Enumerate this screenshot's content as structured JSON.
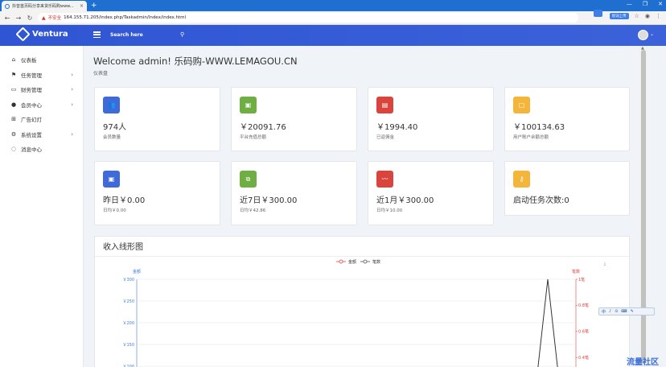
{
  "browser": {
    "tab_title": "抖音首页码分享来货乐码购www...",
    "tab_close": "×",
    "new_tab": "+",
    "controls": [
      "—",
      "❐",
      "✕"
    ],
    "insecure": "不安全",
    "url": "164.155.71.205/index.php/Taskadmin/Index/index.html",
    "ext_badge": "划词上传"
  },
  "header": {
    "brand": "Ventura",
    "search_placeholder": "Search here"
  },
  "sidebar": {
    "items": [
      {
        "label": "仪表板",
        "icon": "home-icon",
        "glyph": "⌂",
        "has_arrow": false
      },
      {
        "label": "任务管理",
        "icon": "flag-icon",
        "glyph": "⚑",
        "has_arrow": true
      },
      {
        "label": "财务管理",
        "icon": "storage-icon",
        "glyph": "▭",
        "has_arrow": true
      },
      {
        "label": "会员中心",
        "icon": "user-icon",
        "glyph": "●",
        "has_arrow": true
      },
      {
        "label": "广告幻灯",
        "icon": "grid-icon",
        "glyph": "⊞",
        "has_arrow": false
      },
      {
        "label": "系统设置",
        "icon": "gear-icon",
        "glyph": "⚙",
        "has_arrow": true
      },
      {
        "label": "消息中心",
        "icon": "message-icon",
        "glyph": "◌",
        "has_arrow": false
      }
    ],
    "arrow": "›"
  },
  "main": {
    "welcome": "Welcome admin! 乐码购-WWW.LEMAGOU.CN",
    "breadcrumb": "仪表盘",
    "cards": [
      {
        "value": "974人",
        "label": "会员数量",
        "color": "#3f6ad8",
        "icon": "users-icon",
        "glyph": "👥"
      },
      {
        "value": "￥20091.76",
        "label": "平台充值总额",
        "color": "#6fae42",
        "icon": "money-icon",
        "glyph": "▣"
      },
      {
        "value": "￥1994.40",
        "label": "已返佣金",
        "color": "#d9453d",
        "icon": "wallet-icon",
        "glyph": "▤"
      },
      {
        "value": "￥100134.63",
        "label": "用户账户余额总额",
        "color": "#f4b63a",
        "icon": "folder-icon",
        "glyph": "▢"
      },
      {
        "value": "昨日￥0.00",
        "label": "日均￥0.00",
        "color": "#3f6ad8",
        "icon": "cash-icon",
        "glyph": "▣"
      },
      {
        "value": "近7日￥300.00",
        "label": "日均￥42.86",
        "color": "#6fae42",
        "icon": "copy-icon",
        "glyph": "⧉"
      },
      {
        "value": "近1月￥300.00",
        "label": "日均￥10.00",
        "color": "#d9453d",
        "icon": "trend-icon",
        "glyph": "〰"
      },
      {
        "value": "启动任务次数:0",
        "label": "",
        "color": "#f4b63a",
        "icon": "key-icon",
        "glyph": "⚷"
      }
    ],
    "chart_title": "收入线形图"
  },
  "chart_data": {
    "type": "line",
    "title": "",
    "legend": [
      "金额",
      "笔数"
    ],
    "legend_placement": "top-center",
    "left_axis": {
      "name": "金额",
      "ticks": [
        "￥300",
        "￥250",
        "￥200",
        "￥150",
        "￥100"
      ],
      "ylim": [
        0,
        300
      ],
      "color": "#3f7be0"
    },
    "right_axis": {
      "name": "笔数",
      "ticks": [
        "1笔",
        "0.8笔",
        "0.6笔",
        "0.4笔"
      ],
      "ylim": [
        0,
        1
      ],
      "color": "#e0443c"
    },
    "series": [
      {
        "name": "笔数",
        "color": "#333333",
        "peak": 1
      }
    ],
    "grid": true,
    "toolbox": "download-icon"
  },
  "float_toolbar": [
    "中",
    "♪",
    "⊙",
    "⌨",
    "✎"
  ],
  "watermark": "流量社区"
}
